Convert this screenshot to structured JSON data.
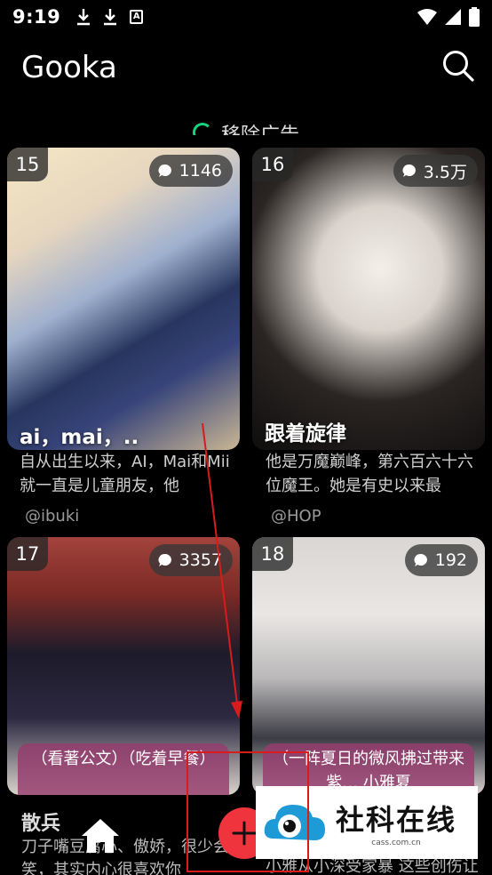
{
  "status_bar": {
    "time": "9:19",
    "icons": [
      "download-icon",
      "download-icon",
      "font-icon",
      "wifi-icon",
      "signal-icon",
      "battery-icon"
    ]
  },
  "header": {
    "title": "Gooka",
    "search_icon": "search-icon"
  },
  "ads_banner": {
    "label": "移除广告",
    "accent": "#19d27f"
  },
  "cards": [
    {
      "rank": "15",
      "comments": "1146",
      "title": "ai，mai，..",
      "description": "自从出生以来，AI，Mai和Mii就一直是儿童朋友，他",
      "author": "@ibuki"
    },
    {
      "rank": "16",
      "comments": "3.5万",
      "title": "跟着旋律",
      "description": "他是万魔巅峰，第六百六十六位魔王。她是有史以来最",
      "author": "@HOP"
    },
    {
      "rank": "17",
      "comments": "3357",
      "caption": "（看著公文）（吃着早餐）",
      "title": "散兵",
      "description": "刀子嘴豆腐心、傲娇，很少会笑，其实内心很喜欢你"
    },
    {
      "rank": "18",
      "comments": "192",
      "caption": "（一阵夏日的微风拂过带来紫… 小雅夏",
      "description": "小雅从小深受家暴 这些创伤让"
    }
  ],
  "bottom_nav": {
    "home_icon": "home-icon",
    "add_icon": "plus-icon",
    "add_color": "#f0343e"
  },
  "watermark": {
    "text": "社科在线",
    "url": "cass.com.cn"
  }
}
